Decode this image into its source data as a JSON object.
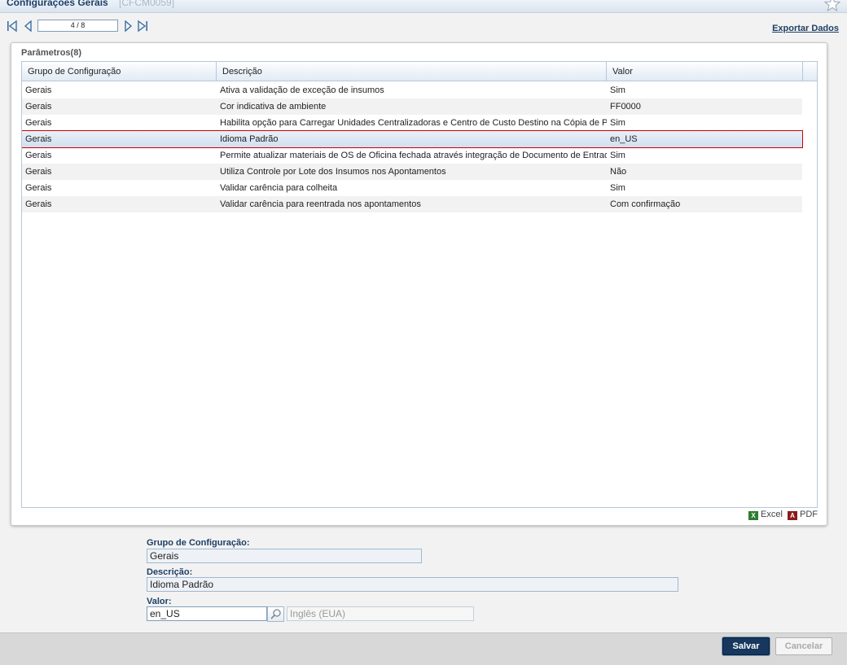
{
  "window": {
    "title": "Configurações Gerais",
    "code": "[CFCM0059]"
  },
  "nav": {
    "page_indicator": "4 / 8",
    "export_label": "Exportar Dados"
  },
  "panel": {
    "title": "Parâmetros(8)"
  },
  "grid": {
    "columns": [
      "Grupo de Configuração",
      "Descrição",
      "Valor"
    ],
    "rows": [
      {
        "grupo": "Gerais",
        "descricao": "Ativa a validação de exceção de insumos",
        "valor": "Sim"
      },
      {
        "grupo": "Gerais",
        "descricao": "Cor indicativa de ambiente",
        "valor": "FF0000"
      },
      {
        "grupo": "Gerais",
        "descricao": "Habilita opção para Carregar Unidades Centralizadoras e Centro de Custo Destino na Cópia de Pac",
        "valor": "Sim"
      },
      {
        "grupo": "Gerais",
        "descricao": "Idioma Padrão",
        "valor": "en_US"
      },
      {
        "grupo": "Gerais",
        "descricao": "Permite atualizar materiais de OS de Oficina fechada através integração de Documento de Entrada",
        "valor": "Sim"
      },
      {
        "grupo": "Gerais",
        "descricao": "Utiliza Controle por Lote dos Insumos nos Apontamentos",
        "valor": "Não"
      },
      {
        "grupo": "Gerais",
        "descricao": "Validar carência para colheita",
        "valor": "Sim"
      },
      {
        "grupo": "Gerais",
        "descricao": "Validar carência para reentrada nos apontamentos",
        "valor": "Com confirmação"
      }
    ],
    "selected_row": 4
  },
  "export_buttons": {
    "excel": "Excel",
    "pdf": "PDF"
  },
  "form": {
    "grupo_label": "Grupo de Configuração:",
    "grupo_value": "Gerais",
    "descricao_label": "Descrição:",
    "descricao_value": "Idioma Padrão",
    "valor_label": "Valor:",
    "valor_value": "en_US",
    "valor_description": "Inglês (EUA)"
  },
  "footer": {
    "save_label": "Salvar",
    "cancel_label": "Cancelar"
  },
  "colors": {
    "accent": "#17375e",
    "selection_outline": "#cc0000",
    "link": "#1e3f66"
  },
  "icons": [
    "star-icon",
    "first-page-icon",
    "prev-page-icon",
    "next-page-icon",
    "last-page-icon",
    "excel-icon",
    "pdf-icon",
    "search-icon"
  ]
}
